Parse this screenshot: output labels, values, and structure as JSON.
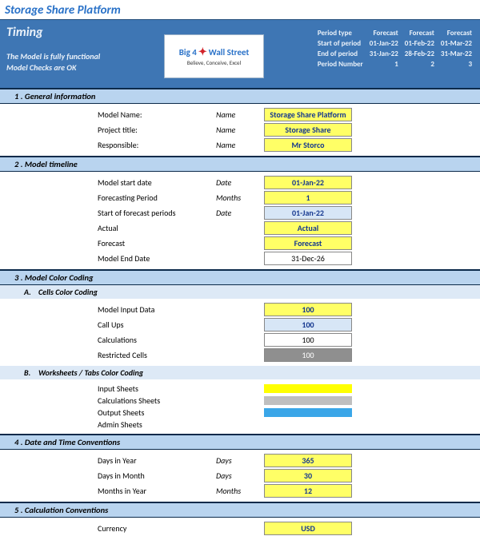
{
  "title": "Storage Share Platform",
  "header": {
    "timing": "Timing",
    "line1": "The Model is fully functional",
    "line2": "Model Checks are OK",
    "logo": {
      "brand_left": "Big 4",
      "brand_right": "Wall Street",
      "tag": "Believe, Conceive, Excel"
    },
    "rlabels": {
      "ptype": "Period type",
      "start": "Start of period",
      "end": "End of period",
      "pnum": "Period Number"
    },
    "periods": [
      {
        "type": "Forecast",
        "start": "01-Jan-22",
        "end": "31-Jan-22",
        "num": "1"
      },
      {
        "type": "Forecast",
        "start": "01-Feb-22",
        "end": "28-Feb-22",
        "num": "2"
      },
      {
        "type": "Forecast",
        "start": "01-Mar-22",
        "end": "31-Mar-22",
        "num": "3"
      }
    ]
  },
  "sections": {
    "s1": "1 .  General information",
    "s2": "2 .  Model timeline",
    "s3": "3 .  Model Color Coding",
    "s3a": "Cells Color Coding",
    "s3b": "Worksheets / Tabs Color Coding",
    "s4": "4 .  Date and Time Conventions",
    "s5": "5 .  Calculation Conventions",
    "letA": "A.",
    "letB": "B."
  },
  "gen": {
    "model_name_l": "Model Name:",
    "model_name": "Storage Share Platform",
    "project_l": "Project title:",
    "project": "Storage Share",
    "resp_l": "Responsible:",
    "resp": "Mr Storco",
    "unit_name": "Name"
  },
  "tl": {
    "mstart_l": "Model start date",
    "mstart": "01-Jan-22",
    "u_date": "Date",
    "fperiod_l": "Forecasting Period",
    "fperiod": "1",
    "u_months": "Months",
    "fstart_l": "Start of forecast periods",
    "fstart": "01-Jan-22",
    "actual_l": "Actual",
    "actual": "Actual",
    "forecast_l": "Forecast",
    "forecast": "Forecast",
    "mend_l": "Model End Date",
    "mend": "31-Dec-26"
  },
  "cc": {
    "input_l": "Model Input Data",
    "input": "100",
    "call_l": "Call Ups",
    "call": "100",
    "calc_l": "Calculations",
    "calc": "100",
    "restr_l": "Restricted Cells",
    "restr": "100",
    "ws_in": "Input Sheets",
    "ws_calc": "Calculations Sheets",
    "ws_out": "Output Sheets",
    "ws_admin": "Admin Sheets"
  },
  "dt": {
    "dyr_l": "Days in Year",
    "dyr": "365",
    "u_days": "Days",
    "dmo_l": "Days in Month",
    "dmo": "30",
    "myr_l": "Months in Year",
    "myr": "12",
    "u_months": "Months"
  },
  "calc": {
    "cur_l": "Currency",
    "cur": "USD"
  }
}
